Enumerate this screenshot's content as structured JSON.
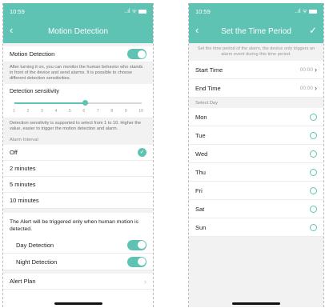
{
  "left": {
    "status": {
      "time": "10:59",
      "signal": "..ıl",
      "wifi": "ᯤ"
    },
    "title": "Motion Detection",
    "motion_detection": {
      "label": "Motion Detection",
      "enabled": true
    },
    "motion_note": "After turning it on, you can monitor the human behavior who stands in front of the device and send alarms. It is possible to choose different detection sensitivities.",
    "sensitivity": {
      "label": "Detection sensitivity",
      "ticks": [
        "1",
        "2",
        "3",
        "4",
        "5",
        "6",
        "7",
        "8",
        "9",
        "10"
      ],
      "value": 6
    },
    "sensitivity_note": "Detection sensitivity is supported to select from 1 to 10. Higher the value, easier to trigger the motion detection and alarm.",
    "alarm_interval": {
      "section_label": "Alarm Interval",
      "options": [
        "Off",
        "2 minutes",
        "5 minutes",
        "10 minutes"
      ],
      "selected": "Off"
    },
    "alert_text": "The Alert will be triggered only when human motion is detected.",
    "day_detection": {
      "label": "Day Detection",
      "enabled": true
    },
    "night_detection": {
      "label": "Night Detection",
      "enabled": true
    },
    "alert_plan": {
      "label": "Alert Plan"
    }
  },
  "right": {
    "status": {
      "time": "10:59",
      "signal": "..ıl",
      "wifi": "ᯤ"
    },
    "title": "Set the Time Period",
    "note": "Set the time period of the alarm, the device only triggers an alarm event during this time period.",
    "start_time": {
      "label": "Start Time",
      "value": "00:00"
    },
    "end_time": {
      "label": "End Time",
      "value": "00:00"
    },
    "select_day_label": "Select Day",
    "days": [
      "Mon",
      "Tue",
      "Wed",
      "Thu",
      "Fri",
      "Sat",
      "Sun"
    ]
  },
  "colors": {
    "accent": "#5fc3b3",
    "background": "#f2f2f2"
  }
}
